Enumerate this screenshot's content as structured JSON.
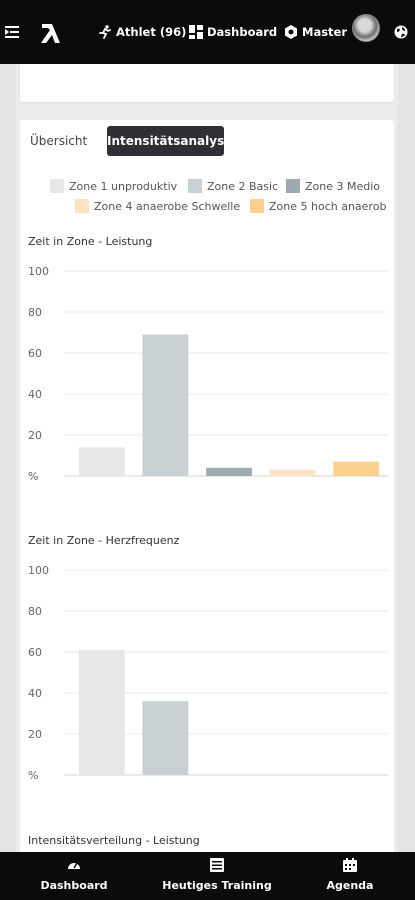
{
  "topbar": {
    "athlet_label": "Athlet (96)",
    "dashboard_label": "Dashboard",
    "master_label": "Master"
  },
  "tabs": [
    {
      "label": "Übersicht",
      "active": false
    },
    {
      "label": "Intensitätsanalyse",
      "active": true
    }
  ],
  "legend": [
    {
      "label": "Zone 1 unproduktiv",
      "color": "#e5e7e9"
    },
    {
      "label": "Zone 2 Basic",
      "color": "#c8d0d4"
    },
    {
      "label": "Zone 3 Medio",
      "color": "#9daab1"
    },
    {
      "label": "Zone 4 anaerobe Schwelle",
      "color": "#fde3c4"
    },
    {
      "label": "Zone 5 hoch anaerob",
      "color": "#fbd08f"
    }
  ],
  "chart_data": [
    {
      "type": "bar",
      "title": "Zeit in Zone - Leistung",
      "categories": [
        "Zone 1 unproduktiv",
        "Zone 2 Basic",
        "Zone 3 Medio",
        "Zone 4 anaerobe Schwelle",
        "Zone 5 hoch anaerob"
      ],
      "values": [
        14,
        69,
        4,
        3,
        7
      ],
      "colors": [
        "#e5e7e9",
        "#c8d0d4",
        "#9daab1",
        "#fde3c4",
        "#fbd08f"
      ],
      "y_ticks": [
        "%",
        "20",
        "40",
        "60",
        "80",
        "100"
      ],
      "ylim": [
        0,
        100
      ],
      "grid": true,
      "legend": "top"
    },
    {
      "type": "bar",
      "title": "Zeit in Zone - Herzfrequenz",
      "categories": [
        "Zone 1 unproduktiv",
        "Zone 2 Basic",
        "Zone 3 Medio",
        "Zone 4 anaerobe Schwelle",
        "Zone 5 hoch anaerob"
      ],
      "values": [
        61,
        36,
        0,
        0,
        0
      ],
      "colors": [
        "#e5e7e9",
        "#c8d0d4",
        "#9daab1",
        "#fde3c4",
        "#fbd08f"
      ],
      "y_ticks": [
        "%",
        "20",
        "40",
        "60",
        "80",
        "100"
      ],
      "ylim": [
        0,
        100
      ],
      "grid": true,
      "legend": "top"
    }
  ],
  "next_section_title": "Intensitätsverteilung - Leistung",
  "bottom_nav": [
    {
      "label": "Dashboard",
      "icon": "gauge-icon"
    },
    {
      "label": "Heutiges Training",
      "icon": "training-list-icon"
    },
    {
      "label": "Agenda",
      "icon": "calendar-icon"
    }
  ]
}
